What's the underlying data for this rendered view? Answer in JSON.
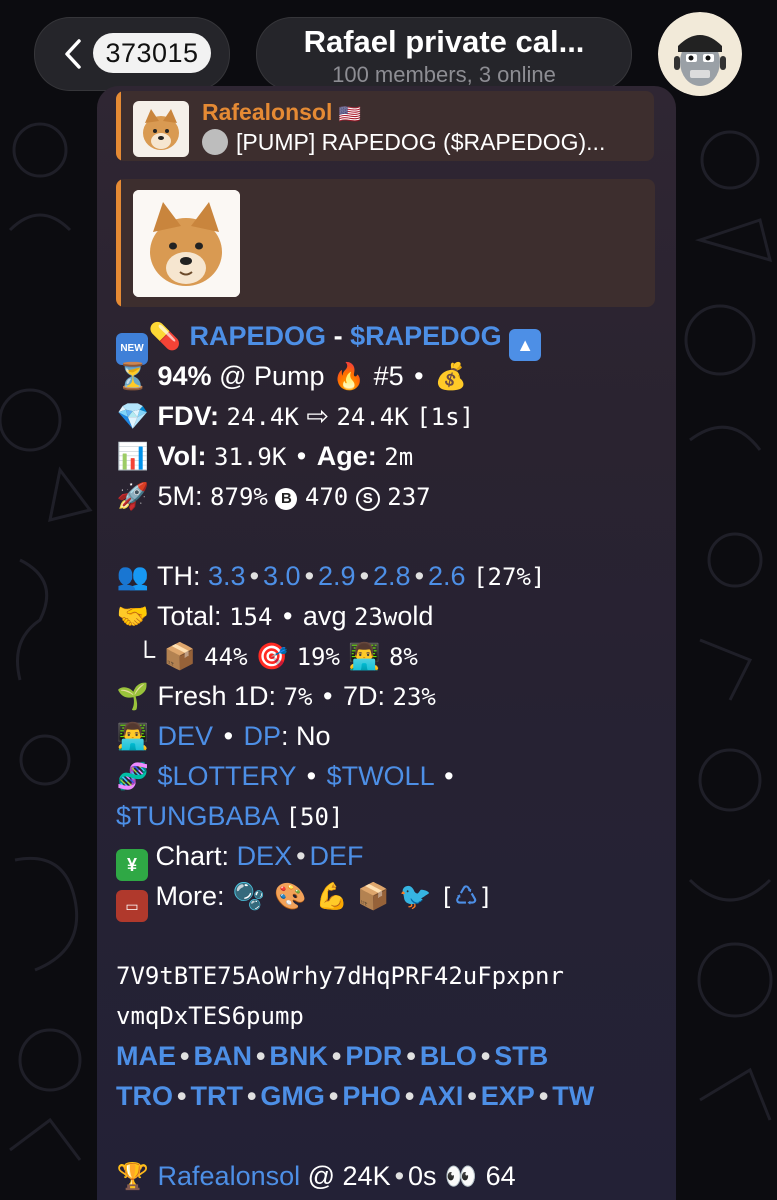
{
  "header": {
    "unread_count": "373015",
    "chat_title": "Rafael private cal...",
    "chat_subtitle": "100 members, 3 online"
  },
  "reply": {
    "author": "Rafealonsol",
    "flag_icon": "us-flag-icon",
    "text": "[PUMP] RAPEDOG ($RAPEDOG)..."
  },
  "message": {
    "l1": {
      "name": "RAPEDOG",
      "dash": "-",
      "ticker": "$RAPEDOG"
    },
    "l2": {
      "pct": "94%",
      "at_pump": "@ Pump",
      "rank": "#5",
      "dot": "•"
    },
    "l3": {
      "fdv_label": "FDV:",
      "fdv_from": "24.4K",
      "arrow": "⇨",
      "fdv_to": "24.4K",
      "age": "[1s]"
    },
    "l4": {
      "vol_label": "Vol:",
      "vol": "31.9K",
      "dot": "•",
      "age_label": "Age:",
      "age": "2m"
    },
    "l5": {
      "label": "5M:",
      "pct": "879%",
      "b_icon": "B",
      "b_val": "470",
      "s_icon": "S",
      "s_val": "237"
    },
    "l6": {
      "label": "TH:",
      "vals": [
        "3.3",
        "3.0",
        "2.9",
        "2.8",
        "2.6"
      ],
      "pct": "[27%]"
    },
    "l7": {
      "label": "Total:",
      "total": "154",
      "dot": "•",
      "avg_label": "avg",
      "avg": "23w",
      "old": "old"
    },
    "l8": {
      "tree": "└",
      "p1": "44%",
      "p2": "19%",
      "p3": "8%"
    },
    "l9": {
      "fresh_label": "Fresh 1D:",
      "fresh1d": "7%",
      "dot": "•",
      "d7_label": "7D:",
      "d7": "23%"
    },
    "l10": {
      "dev": "DEV",
      "dot": "•",
      "dp": "DP",
      "dp_value": ": No"
    },
    "l11": {
      "t1": "$LOTTERY",
      "dot": "•",
      "t2": "$TWOLL",
      "dot2": "•"
    },
    "l12": {
      "t3": "$TUNGBABA",
      "count": "[50]"
    },
    "l13": {
      "label": "Chart:",
      "dex": "DEX",
      "dot": "•",
      "def": "DEF"
    },
    "l14": {
      "label": "More:",
      "bracket_open": "[",
      "bracket_close": "]"
    },
    "ca1": "7V9tBTE75AoWrhy7dHqPRF42uFpxpnr",
    "ca2": "vmqDxTES6pump",
    "links1": [
      "MAE",
      "BAN",
      "BNK",
      "PDR",
      "BLO",
      "STB"
    ],
    "links2": [
      "TRO",
      "TRT",
      "GMG",
      "PHO",
      "AXI",
      "EXP",
      "TW"
    ],
    "l18": {
      "author": "Rafealonsol",
      "mid": "@ 24K",
      "dot": "•",
      "time": "0s",
      "count": "64"
    }
  },
  "colors": {
    "link": "#4d8fe6",
    "reply_accent": "#e58a34"
  }
}
